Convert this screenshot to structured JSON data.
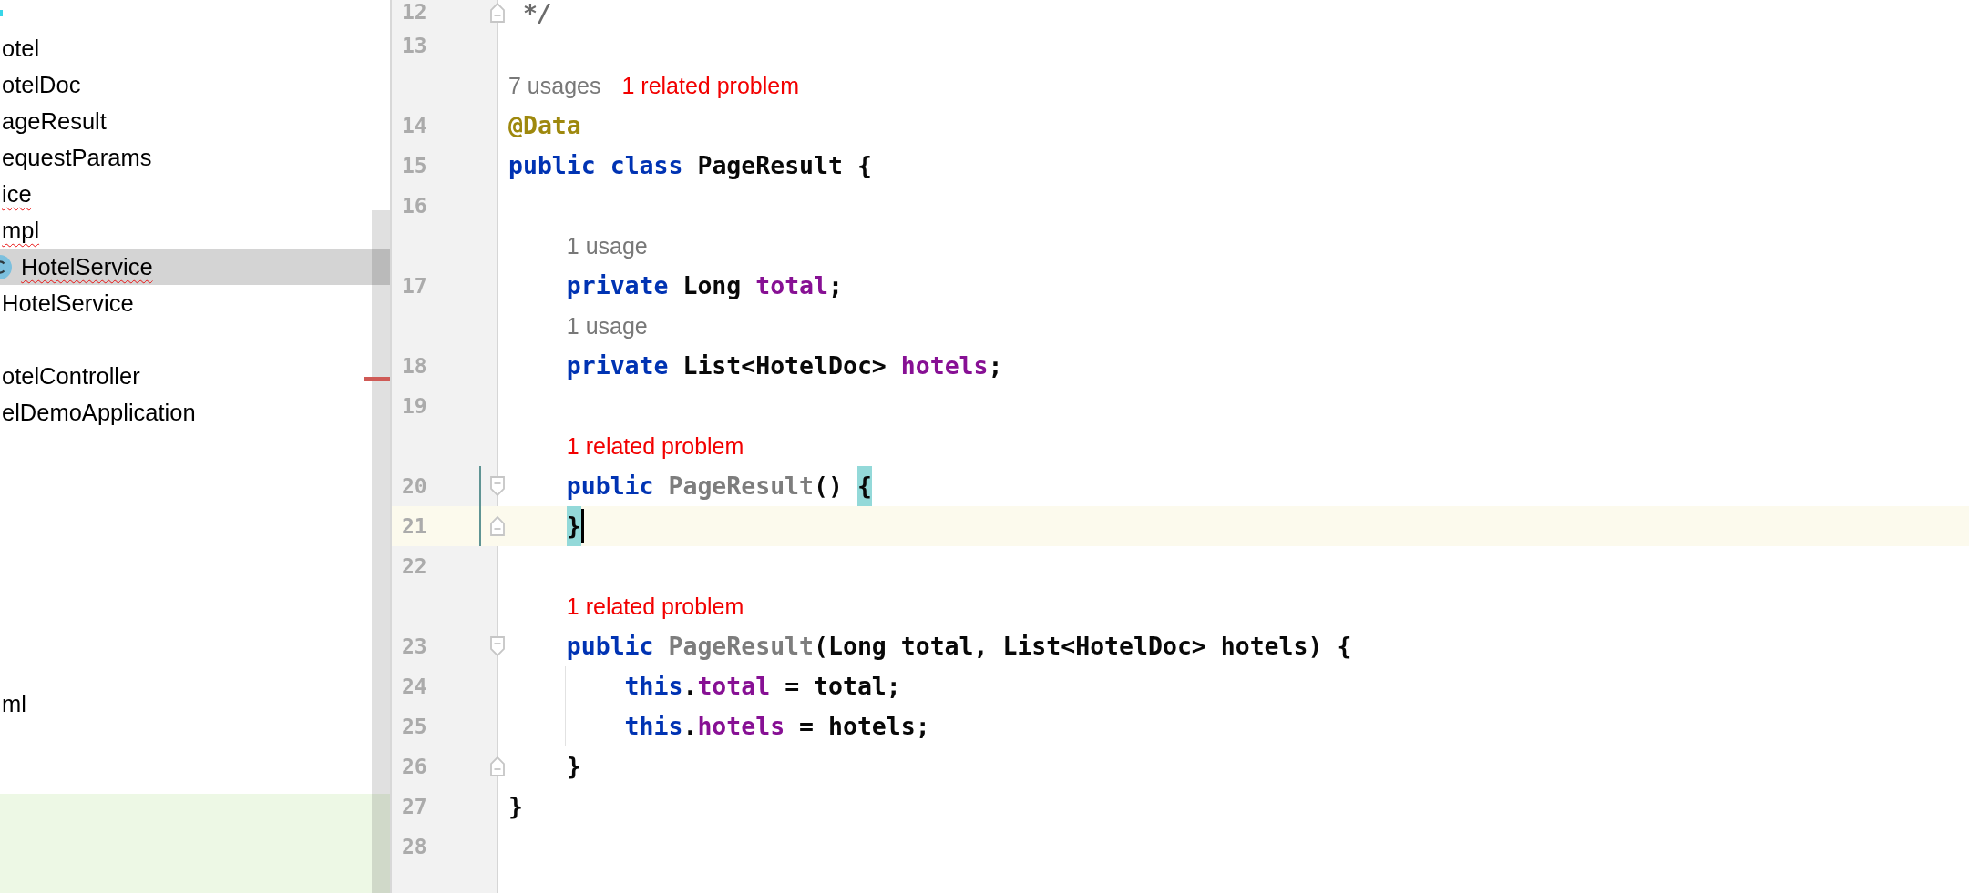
{
  "project_tree": {
    "groups": [
      {
        "items": [
          {
            "label": "otel",
            "kind": "text",
            "selected": false,
            "error": false
          },
          {
            "label": "otelDoc",
            "kind": "text",
            "selected": false,
            "error": false
          },
          {
            "label": "ageResult",
            "kind": "text",
            "selected": false,
            "error": false
          },
          {
            "label": "equestParams",
            "kind": "text",
            "selected": false,
            "error": false
          },
          {
            "label": "ice",
            "kind": "text",
            "selected": false,
            "error": true
          },
          {
            "label": "mpl",
            "kind": "text",
            "selected": false,
            "error": true
          },
          {
            "label": "HotelService",
            "kind": "class",
            "selected": true,
            "error": true
          },
          {
            "label": "HotelService",
            "kind": "text",
            "selected": false,
            "error": false
          }
        ]
      },
      {
        "items": [
          {
            "label": "otelController",
            "kind": "text",
            "selected": false,
            "error": false
          },
          {
            "label": "elDemoApplication",
            "kind": "text",
            "selected": false,
            "error": false
          }
        ]
      },
      {
        "items": [
          {
            "label": "ml",
            "kind": "text",
            "selected": false,
            "error": false
          }
        ]
      }
    ]
  },
  "editor": {
    "lines": [
      {
        "number": "12",
        "kind": "fold-end",
        "current": false,
        "caret": false,
        "modified": false,
        "tokens": [
          {
            "text": "*/",
            "kind": "comment"
          }
        ]
      },
      {
        "number": "13",
        "kind": "plain",
        "current": false,
        "caret": false,
        "modified": false
      },
      {
        "number": "14",
        "kind": "plain",
        "current": false,
        "caret": false,
        "modified": false,
        "hints": [
          {
            "text": "7 usages",
            "kind": "usages"
          },
          {
            "text": "1 related problem",
            "kind": "problem"
          }
        ],
        "tokens": [
          {
            "text": "@Data",
            "kind": "annotation"
          }
        ]
      },
      {
        "number": "15",
        "kind": "plain",
        "current": false,
        "caret": false,
        "modified": false,
        "tokens": [
          {
            "text": "public ",
            "kind": "keyword"
          },
          {
            "text": "class",
            "kind": "keyword"
          },
          {
            "text": " PageResult {",
            "kind": "plain"
          }
        ],
        "children": [
          {
            "number": "16",
            "kind": "plain",
            "current": false,
            "caret": false,
            "modified": false
          },
          {
            "number": "17",
            "kind": "plain",
            "current": false,
            "caret": false,
            "modified": false,
            "hints": [
              {
                "text": "1 usage",
                "kind": "usages"
              }
            ],
            "tokens": [
              {
                "text": "private",
                "kind": "keyword"
              },
              {
                "text": " Long ",
                "kind": "plain"
              },
              {
                "text": "total",
                "kind": "field"
              },
              {
                "text": ";",
                "kind": "plain"
              }
            ]
          },
          {
            "number": "18",
            "kind": "plain",
            "current": false,
            "caret": false,
            "modified": false,
            "hints": [
              {
                "text": "1 usage",
                "kind": "usages"
              }
            ],
            "tokens": [
              {
                "text": "private",
                "kind": "keyword"
              },
              {
                "text": " List<HotelDoc> ",
                "kind": "plain"
              },
              {
                "text": "hotels",
                "kind": "field"
              },
              {
                "text": ";",
                "kind": "plain"
              }
            ]
          },
          {
            "number": "19",
            "kind": "plain",
            "current": false,
            "caret": false,
            "modified": false
          },
          {
            "number": "20",
            "kind": "fold-start",
            "current": false,
            "caret": false,
            "modified": true,
            "hints": [
              {
                "text": "1 related problem",
                "kind": "problem"
              }
            ],
            "tokens": [
              {
                "text": "public ",
                "kind": "keyword"
              },
              {
                "text": "PageResult",
                "kind": "unused"
              },
              {
                "text": "() ",
                "kind": "plain"
              },
              {
                "text": "{",
                "kind": "bracematch"
              }
            ]
          },
          {
            "number": "21",
            "kind": "fold-end",
            "current": true,
            "caret": true,
            "modified": true,
            "tokens": [
              {
                "text": "}",
                "kind": "bracematch"
              }
            ]
          },
          {
            "number": "22",
            "kind": "plain",
            "current": false,
            "caret": false,
            "modified": false
          },
          {
            "number": "23",
            "kind": "fold-start",
            "current": false,
            "caret": false,
            "modified": false,
            "hints": [
              {
                "text": "1 related problem",
                "kind": "problem"
              }
            ],
            "tokens": [
              {
                "text": "public ",
                "kind": "keyword"
              },
              {
                "text": "PageResult",
                "kind": "unused"
              },
              {
                "text": "(Long total, List<HotelDoc> hotels) {",
                "kind": "plain"
              }
            ],
            "children": [
              {
                "number": "24",
                "kind": "plain",
                "current": false,
                "caret": false,
                "modified": false,
                "tokens": [
                  {
                    "text": "this",
                    "kind": "keyword"
                  },
                  {
                    "text": ".",
                    "kind": "plain"
                  },
                  {
                    "text": "total",
                    "kind": "field"
                  },
                  {
                    "text": " = total;",
                    "kind": "plain"
                  }
                ]
              },
              {
                "number": "25",
                "kind": "plain",
                "current": false,
                "caret": false,
                "modified": false,
                "tokens": [
                  {
                    "text": "this",
                    "kind": "keyword"
                  },
                  {
                    "text": ".",
                    "kind": "plain"
                  },
                  {
                    "text": "hotels",
                    "kind": "field"
                  },
                  {
                    "text": " = hotels;",
                    "kind": "plain"
                  }
                ]
              }
            ]
          },
          {
            "number": "26",
            "kind": "fold-end",
            "current": false,
            "caret": false,
            "modified": false,
            "tokens": [
              {
                "text": "}",
                "kind": "plain"
              }
            ]
          }
        ]
      },
      {
        "number": "27",
        "kind": "plain",
        "current": false,
        "caret": false,
        "modified": false,
        "tokens": [
          {
            "text": "}",
            "kind": "plain"
          }
        ]
      },
      {
        "number": "28",
        "kind": "plain",
        "current": false,
        "caret": false,
        "modified": false
      }
    ]
  }
}
